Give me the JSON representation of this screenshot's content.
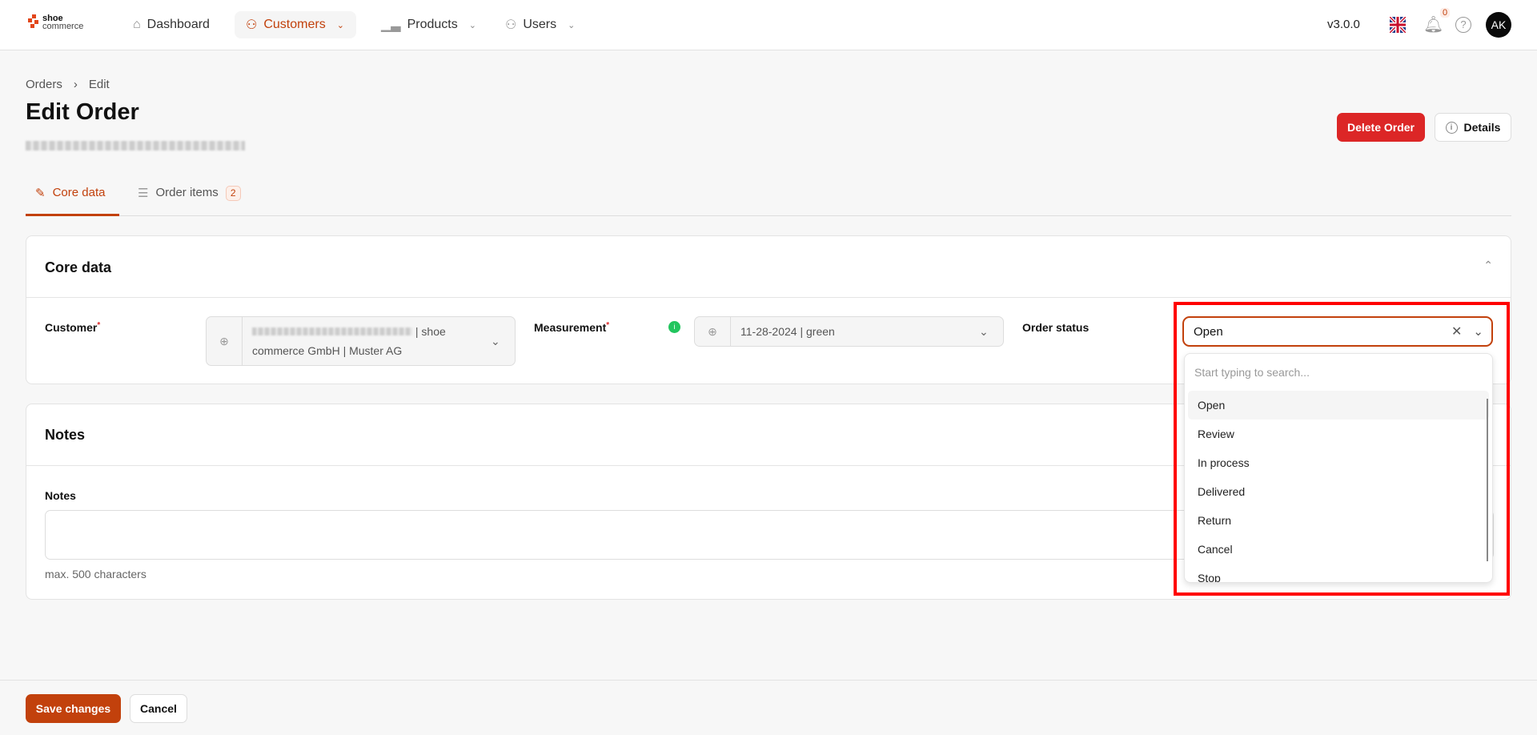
{
  "header": {
    "logo_line1": "shoe",
    "logo_line2": "commerce",
    "nav": [
      {
        "label": "Dashboard"
      },
      {
        "label": "Customers"
      },
      {
        "label": "Products"
      },
      {
        "label": "Users"
      }
    ],
    "version": "v3.0.0",
    "notification_count": "0",
    "avatar_initials": "AK"
  },
  "breadcrumb": {
    "items": [
      "Orders",
      "Edit"
    ]
  },
  "page": {
    "title": "Edit Order",
    "delete_label": "Delete Order",
    "details_label": "Details"
  },
  "tabs": [
    {
      "label": "Core data"
    },
    {
      "label": "Order items",
      "badge": "2"
    }
  ],
  "core": {
    "title": "Core data",
    "customer_label": "Customer",
    "customer_value": "| shoe commerce GmbH | Muster AG",
    "measurement_label": "Measurement",
    "measurement_value": "11-28-2024 | green",
    "status_label": "Order status",
    "status_value": "Open"
  },
  "dropdown": {
    "placeholder": "Start typing to search...",
    "options": [
      "Open",
      "Review",
      "In process",
      "Delivered",
      "Return",
      "Cancel",
      "Stop"
    ]
  },
  "notes": {
    "title": "Notes",
    "label": "Notes",
    "hint": "max. 500 characters"
  },
  "footer": {
    "save_label": "Save changes",
    "cancel_label": "Cancel"
  },
  "colors": {
    "accent": "#c2410c",
    "danger": "#dc2626",
    "highlight": "#ff0000"
  }
}
